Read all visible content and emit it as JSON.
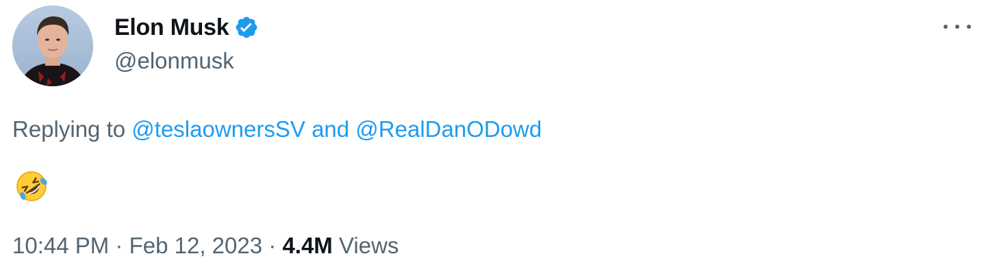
{
  "author": {
    "display_name": "Elon Musk",
    "handle": "@elonmusk",
    "verified_color": "#1d9bf0"
  },
  "reply": {
    "prefix": "Replying to",
    "first_mention": "@teslaownersSV",
    "conjunction": "and",
    "second_mention": "@RealDanODowd"
  },
  "body": {
    "emoji_name": "rolling-on-the-floor-laughing-emoji"
  },
  "meta": {
    "time": "10:44 PM",
    "separator": "·",
    "date": "Feb 12, 2023",
    "views_count": "4.4M",
    "views_label": "Views"
  },
  "colors": {
    "text_primary": "#0f1419",
    "text_secondary": "#536471",
    "link": "#1d9bf0"
  }
}
